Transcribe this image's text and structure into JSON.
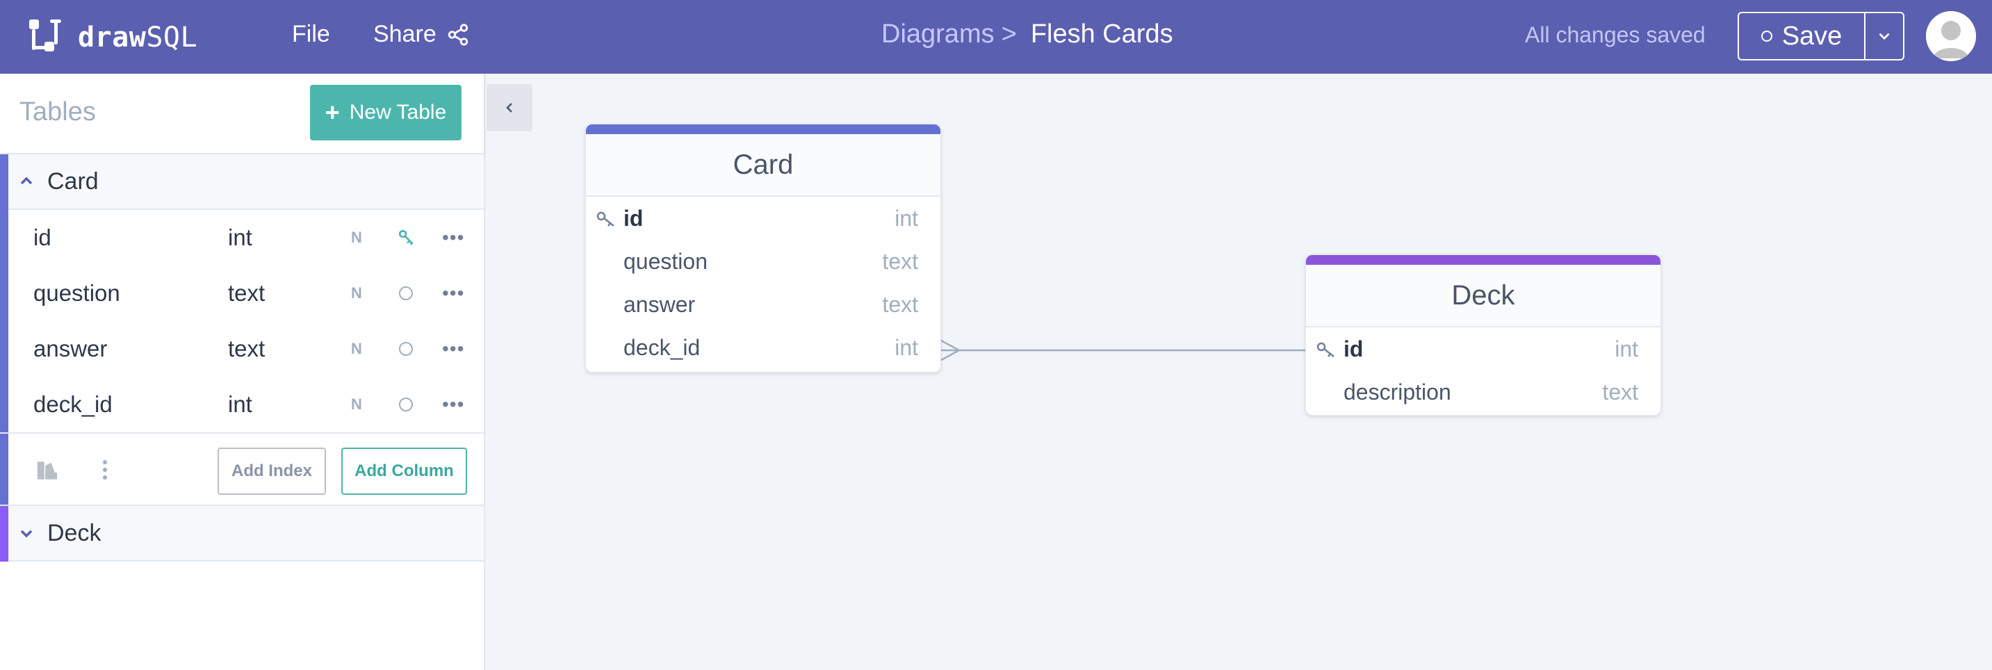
{
  "app": {
    "brand_prefix": "draw",
    "brand_suffix": "SQL"
  },
  "nav": {
    "file": "File",
    "share": "Share"
  },
  "breadcrumb": {
    "parent": "Diagrams",
    "separator": ">",
    "current": "Flesh Cards"
  },
  "status": {
    "saved_text": "All changes saved"
  },
  "save": {
    "label": "Save"
  },
  "sidebar": {
    "title": "Tables",
    "new_table_label": "New Table",
    "tables": [
      {
        "name": "Card",
        "expanded": true,
        "accent": "#6670d2",
        "columns": [
          {
            "name": "id",
            "type": "int",
            "nullable_label": "N",
            "primary_key": true
          },
          {
            "name": "question",
            "type": "text",
            "nullable_label": "N",
            "primary_key": false
          },
          {
            "name": "answer",
            "type": "text",
            "nullable_label": "N",
            "primary_key": false
          },
          {
            "name": "deck_id",
            "type": "int",
            "nullable_label": "N",
            "primary_key": false
          }
        ],
        "add_index_label": "Add Index",
        "add_column_label": "Add Column"
      },
      {
        "name": "Deck",
        "expanded": false,
        "accent": "#8b5cf6"
      }
    ]
  },
  "diagram": {
    "tables": [
      {
        "name": "Card",
        "color": "#6670d2",
        "fields": [
          {
            "name": "id",
            "type": "int",
            "key": true
          },
          {
            "name": "question",
            "type": "text",
            "key": false
          },
          {
            "name": "answer",
            "type": "text",
            "key": false
          },
          {
            "name": "deck_id",
            "type": "int",
            "key": false
          }
        ]
      },
      {
        "name": "Deck",
        "color": "#8a55d9",
        "fields": [
          {
            "name": "id",
            "type": "int",
            "key": true
          },
          {
            "name": "description",
            "type": "text",
            "key": false
          }
        ]
      }
    ],
    "relations": [
      {
        "from_table": "Card",
        "from_field": "deck_id",
        "to_table": "Deck",
        "to_field": "id",
        "cardinality": "many-to-one"
      }
    ]
  },
  "colors": {
    "topbar": "#5a5fb0",
    "accent_teal": "#4db6ac",
    "canvas": "#f1f4f8"
  }
}
